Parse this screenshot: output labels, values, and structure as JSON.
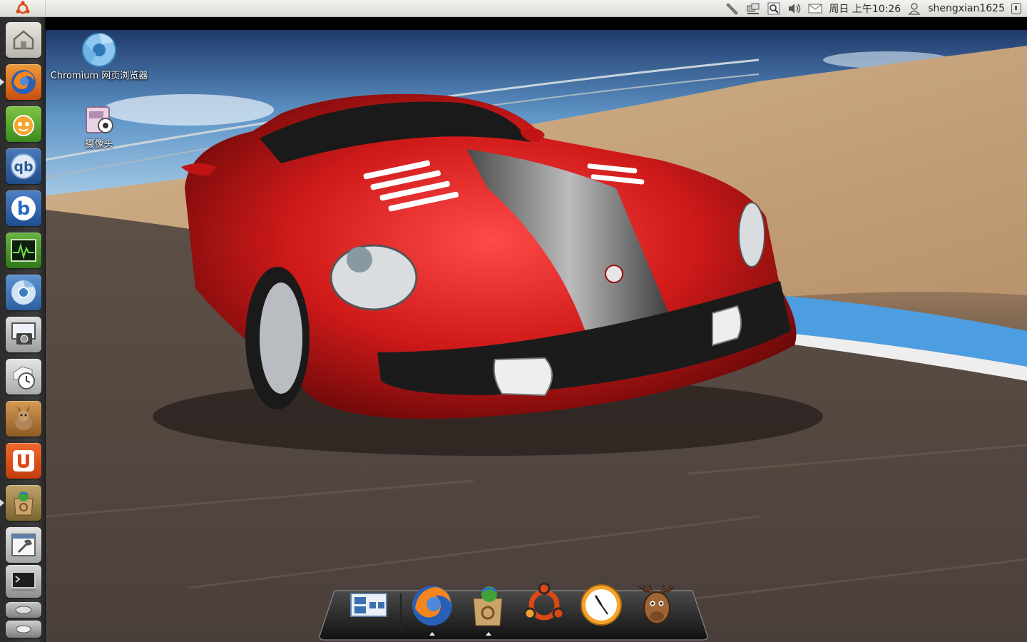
{
  "top_panel": {
    "datetime": "周日 上午10:26",
    "username": "shengxian1625",
    "tray_icons": [
      "network-tools-icon",
      "network-icon",
      "search-icon",
      "volume-icon",
      "mail-icon"
    ]
  },
  "desktop_icons": [
    {
      "name": "chromium-desktop-icon",
      "label": "Chromium 网页浏览器"
    },
    {
      "name": "camera-desktop-icon",
      "label": "摄像头"
    }
  ],
  "launcher": {
    "items": [
      {
        "name": "home-folder-icon"
      },
      {
        "name": "firefox-icon",
        "running": true
      },
      {
        "name": "pps-player-icon"
      },
      {
        "name": "qbittorrent-icon"
      },
      {
        "name": "blueman-icon"
      },
      {
        "name": "system-monitor-icon"
      },
      {
        "name": "chromium-icon"
      },
      {
        "name": "screenshot-icon"
      },
      {
        "name": "time-backup-icon"
      },
      {
        "name": "emesene-icon"
      },
      {
        "name": "ubuntu-one-icon"
      },
      {
        "name": "software-center-icon",
        "running": true
      },
      {
        "name": "settings-icon"
      },
      {
        "name": "terminal-icon"
      }
    ]
  },
  "dock": {
    "items": [
      {
        "name": "workspace-switcher-icon"
      },
      {
        "name": "firefox-icon",
        "running": true
      },
      {
        "name": "software-center-icon",
        "running": true
      },
      {
        "name": "ubuntu-icon"
      },
      {
        "name": "clock-icon"
      },
      {
        "name": "moose-icon"
      }
    ]
  }
}
